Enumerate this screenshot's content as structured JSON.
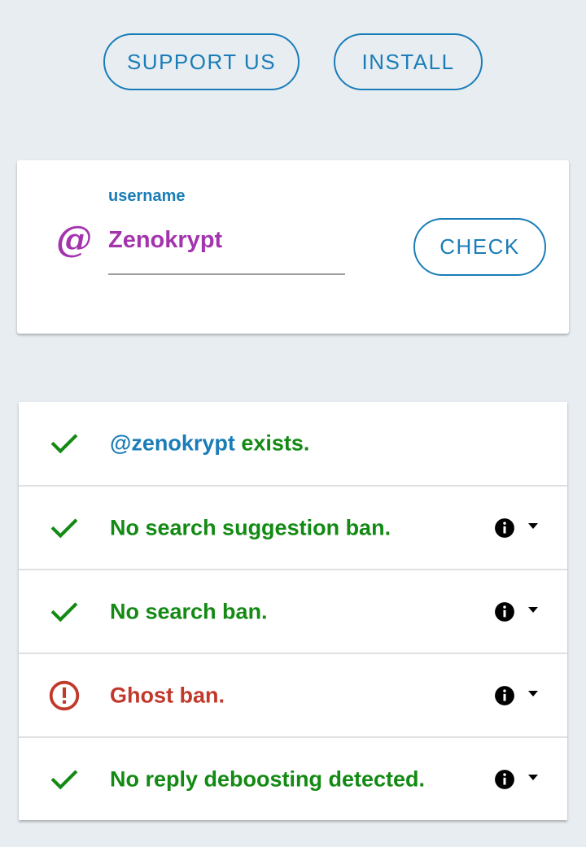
{
  "top_buttons": {
    "support_label": "SUPPORT US",
    "install_label": "INSTALL"
  },
  "form": {
    "at_symbol": "@",
    "label": "username",
    "value": "Zenokrypt",
    "check_label": "CHECK"
  },
  "results": [
    {
      "status": "ok",
      "icon": "checkmark-icon",
      "handle": "@zenokrypt",
      "text": " exists.",
      "has_info": false
    },
    {
      "status": "ok",
      "icon": "checkmark-icon",
      "handle": "",
      "text": "No search suggestion ban.",
      "has_info": true
    },
    {
      "status": "ok",
      "icon": "checkmark-icon",
      "handle": "",
      "text": "No search ban.",
      "has_info": true
    },
    {
      "status": "bad",
      "icon": "alert-circle-icon",
      "handle": "",
      "text": "Ghost ban.",
      "has_info": true
    },
    {
      "status": "ok",
      "icon": "checkmark-icon",
      "handle": "",
      "text": "No reply deboosting detected.",
      "has_info": true
    }
  ],
  "colors": {
    "background": "#e8edf1",
    "accent_blue": "#1a7db8",
    "purple": "#a334ad",
    "success_green": "#138a13",
    "error_red": "#c0392b"
  }
}
